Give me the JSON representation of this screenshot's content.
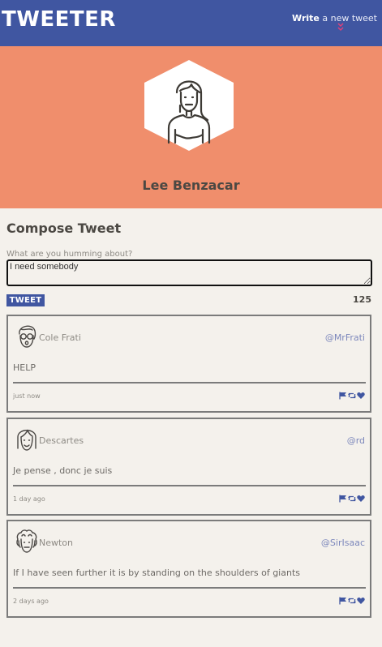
{
  "nav": {
    "brand": "TWEETER",
    "write_bold": "Write",
    "write_rest": " a new tweet",
    "toggle_icon": "double-chevron-down-icon"
  },
  "profile": {
    "name": "Lee Benzacar",
    "avatar_icon": "female-user-avatar-icon"
  },
  "compose": {
    "title": "Compose Tweet",
    "label": "What are you humming about?",
    "value": "I need somebody",
    "button": "TWEET",
    "counter": "125"
  },
  "tweets": [
    {
      "name": "Cole Frati",
      "handle": "@MrFrati",
      "text": "HELP",
      "time": "just now",
      "avatar_icon": "glasses-user-avatar-icon"
    },
    {
      "name": "Descartes",
      "handle": "@rd",
      "text": "Je pense , donc je suis",
      "time": "1 day ago",
      "avatar_icon": "long-hair-user-avatar-icon"
    },
    {
      "name": "Newton",
      "handle": "@SirIsaac",
      "text": "If I have seen further it is by standing on the shoulders of giants",
      "time": "2 days ago",
      "avatar_icon": "curly-hair-user-avatar-icon"
    }
  ],
  "action_icons": [
    "flag-icon",
    "retweet-icon",
    "heart-icon"
  ],
  "colors": {
    "nav": "#4056a1",
    "hero": "#f08e6c",
    "page": "#f4f1ec",
    "chevron": "#e0407a"
  }
}
